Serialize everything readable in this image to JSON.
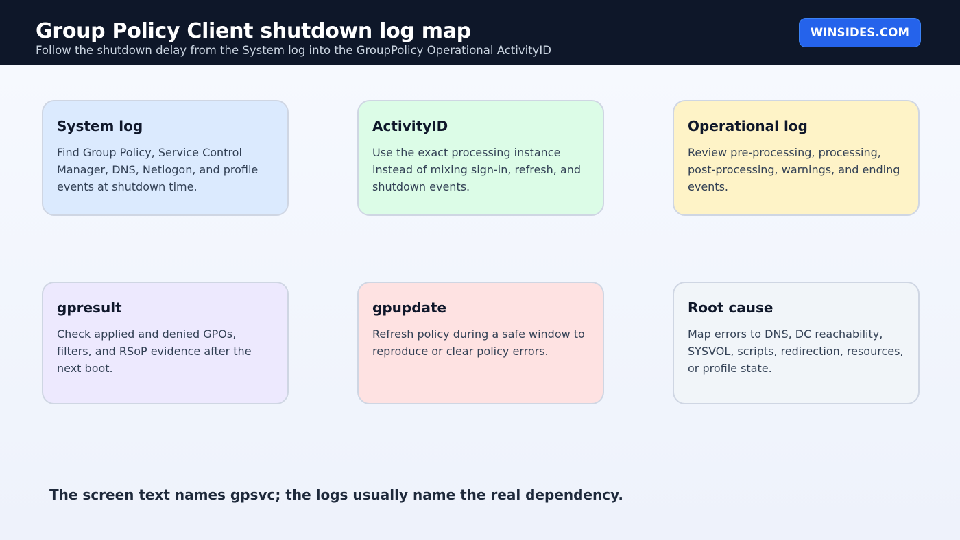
{
  "header": {
    "title": "Group Policy Client shutdown log map",
    "subtitle": "Follow the shutdown delay from the System log into the GroupPolicy Operational ActivityID",
    "brand_label": "WINSIDES.COM"
  },
  "cards": [
    {
      "title": "System log",
      "body": "Find Group Policy, Service Control Manager, DNS, Netlogon, and profile events at shutdown time.",
      "color": "#dbeafe"
    },
    {
      "title": "ActivityID",
      "body": "Use the exact processing instance instead of mixing sign-in, refresh, and shutdown events.",
      "color": "#dcfce7"
    },
    {
      "title": "Operational log",
      "body": "Review pre-processing, processing, post-processing, warnings, and ending events.",
      "color": "#fef3c7"
    },
    {
      "title": "gpresult",
      "body": "Check applied and denied GPOs, filters, and RSoP evidence after the next boot.",
      "color": "#ede9fe"
    },
    {
      "title": "gpupdate",
      "body": "Refresh policy during a safe window to reproduce or clear policy errors.",
      "color": "#fee2e2"
    },
    {
      "title": "Root cause",
      "body": "Map errors to DNS, DC reachability, SYSVOL, scripts, redirection, resources, or profile state.",
      "color": "#f1f5f9"
    }
  ],
  "footer": {
    "note": "The screen text names gpsvc; the logs usually name the real dependency."
  },
  "colors": {
    "header_bg": "#0e1729",
    "accent": "#2563eb"
  }
}
